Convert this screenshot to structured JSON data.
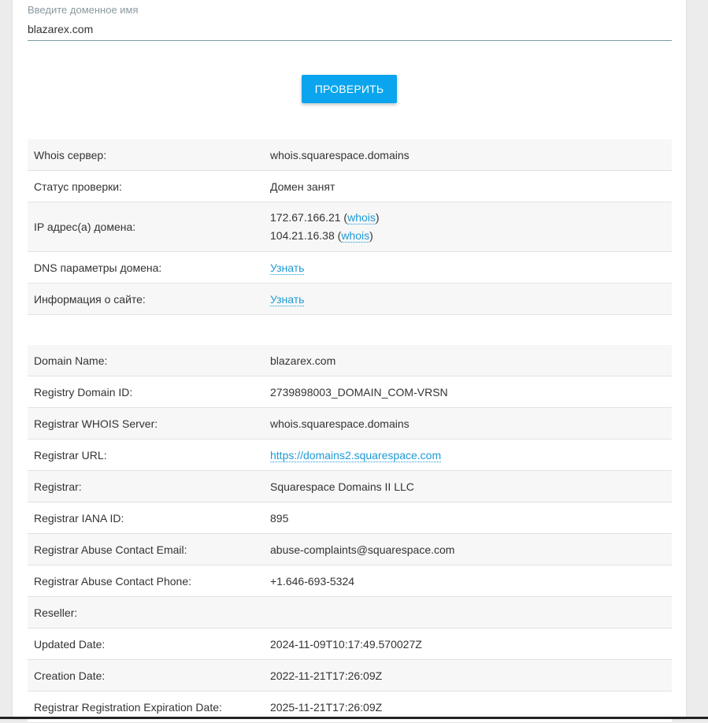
{
  "search": {
    "label": "Введите доменное имя",
    "value": "blazarex.com",
    "button": "ПРОВЕРИТЬ"
  },
  "check": {
    "whois_server_label": "Whois сервер:",
    "whois_server_value": "whois.squarespace.domains",
    "status_label": "Статус проверки:",
    "status_value": "Домен занят",
    "ip_label": "IP адрес(а) домена:",
    "ips": [
      {
        "ip": "172.67.166.21",
        "link": "whois"
      },
      {
        "ip": "104.21.16.38",
        "link": "whois"
      }
    ],
    "dns_label": "DNS параметры домена:",
    "dns_link": "Узнать",
    "site_label": "Информация о сайте:",
    "site_link": "Узнать"
  },
  "whois": {
    "domain_name_label": "Domain Name:",
    "domain_name_value": "blazarex.com",
    "registry_domain_id_label": "Registry Domain ID:",
    "registry_domain_id_value": "2739898003_DOMAIN_COM-VRSN",
    "registrar_whois_server_label": "Registrar WHOIS Server:",
    "registrar_whois_server_value": "whois.squarespace.domains",
    "registrar_url_label": "Registrar URL:",
    "registrar_url_value": "https://domains2.squarespace.com",
    "registrar_label": "Registrar:",
    "registrar_value": "Squarespace Domains II LLC",
    "iana_id_label": "Registrar IANA ID:",
    "iana_id_value": "895",
    "abuse_email_label": "Registrar Abuse Contact Email:",
    "abuse_email_value": "abuse-complaints@squarespace.com",
    "abuse_phone_label": "Registrar Abuse Contact Phone:",
    "abuse_phone_value": "+1.646-693-5324",
    "reseller_label": "Reseller:",
    "reseller_value": "",
    "updated_label": "Updated Date:",
    "updated_value": "2024-11-09T10:17:49.570027Z",
    "created_label": "Creation Date:",
    "created_value": "2022-11-21T17:26:09Z",
    "expiry_label": "Registrar Registration Expiration Date:",
    "expiry_value": "2025-11-21T17:26:09Z"
  }
}
